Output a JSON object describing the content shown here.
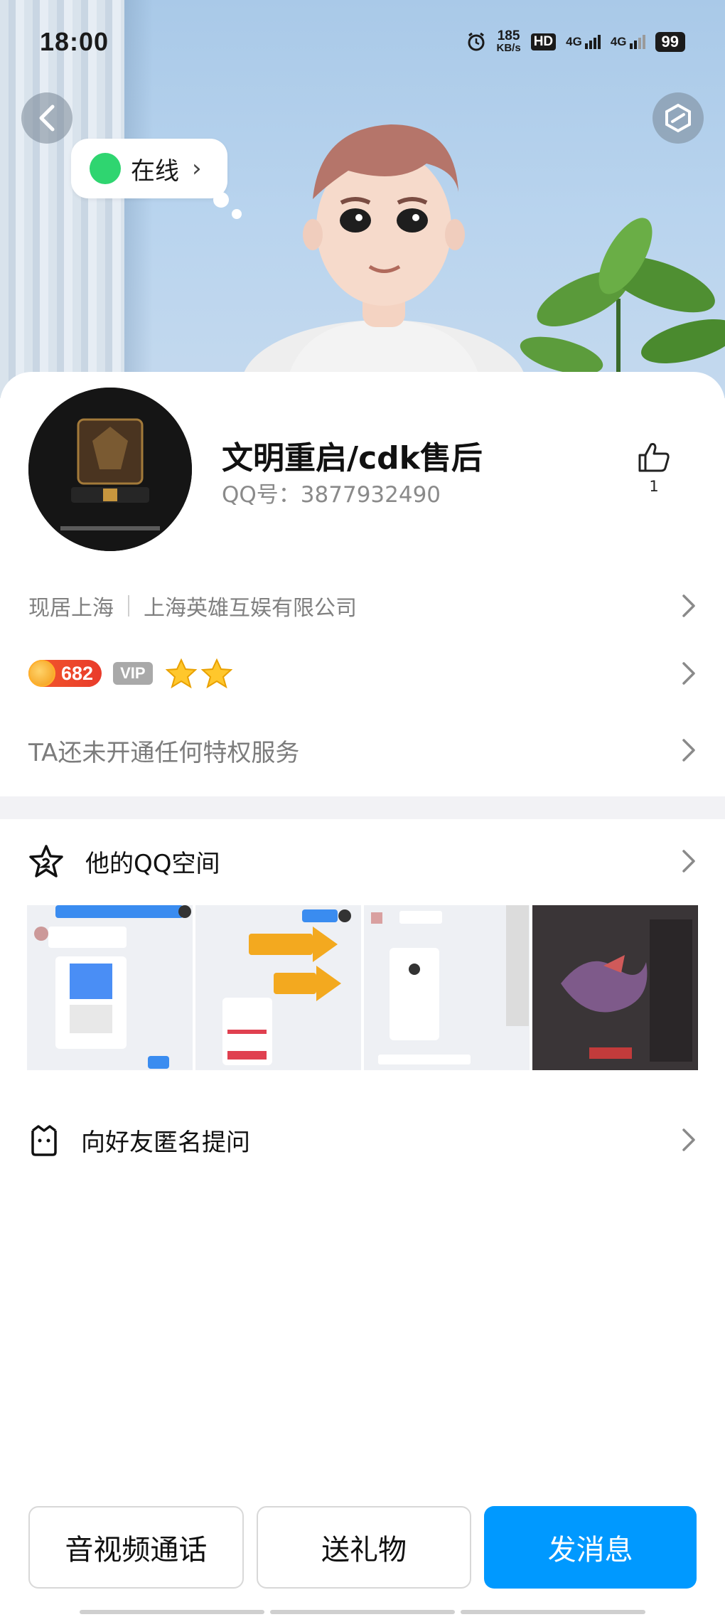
{
  "status_bar": {
    "time": "18:00",
    "speed_value": "185",
    "speed_unit": "KB/s",
    "network_1": "HD",
    "network_2": "4G",
    "network_3": "4G",
    "battery": "99",
    "icons": [
      "alarm-icon",
      "hd-icon",
      "signal-icon",
      "signal-icon"
    ]
  },
  "header": {
    "online_status": "在线",
    "back_icon": "chevron-left-icon",
    "share_icon": "share-icon"
  },
  "profile": {
    "name": "文明重启/cdk售后",
    "qq_id": "QQ号：3877932490",
    "likes": "1",
    "like_icon": "thumbs-up-icon"
  },
  "info": {
    "location": "现居上海",
    "company": "上海英雄互娱有限公司",
    "level_value": "682",
    "vip_label": "VIP",
    "star_count": 2,
    "privilege_text": "TA还未开通任何特权服务"
  },
  "qzone": {
    "title": "他的QQ空间",
    "icon": "star-icon",
    "thumbnail_count": 4
  },
  "ask": {
    "title": "向好友匿名提问",
    "icon": "bag-icon"
  },
  "actions": {
    "call": "音视频通话",
    "gift": "送礼物",
    "message": "发消息"
  },
  "colors": {
    "accent": "#0099ff",
    "online": "#2fd570",
    "level": "#e93b2b",
    "text_muted": "#808080"
  }
}
